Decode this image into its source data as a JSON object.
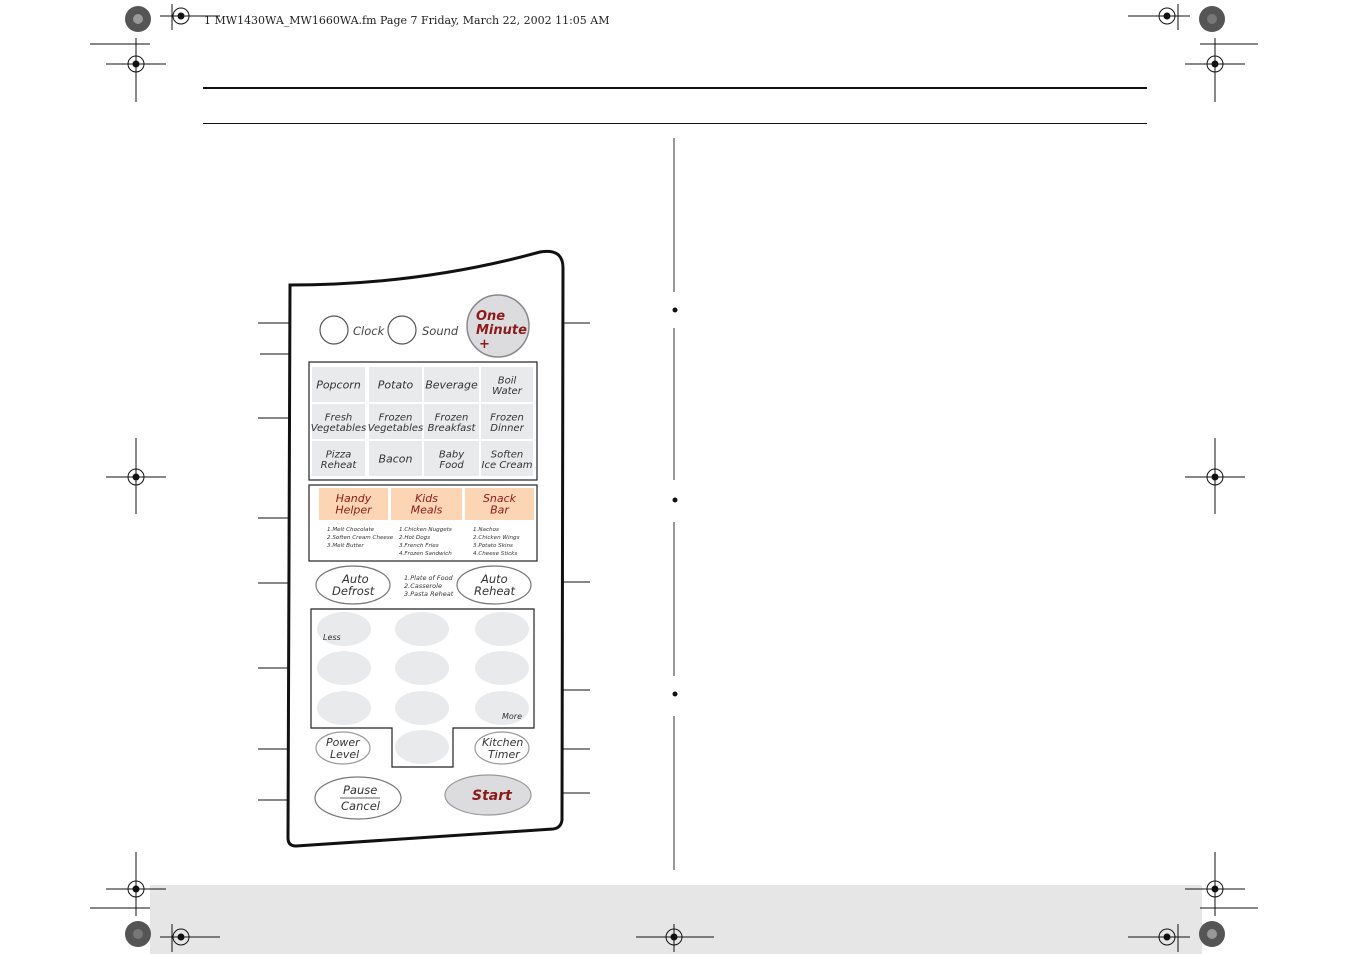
{
  "header": {
    "file_line": "1 MW1430WA_MW1660WA.fm  Page 7  Friday, March 22, 2002  11:05 AM"
  },
  "panel": {
    "clock": "Clock",
    "sound": "Sound",
    "one_minute": [
      "One",
      "Minute",
      "+"
    ],
    "food_grid": [
      [
        [
          "Popcorn"
        ],
        [
          "Potato"
        ],
        [
          "Beverage"
        ],
        [
          "Boil",
          "Water"
        ]
      ],
      [
        [
          "Fresh",
          "Vegetables"
        ],
        [
          "Frozen",
          "Vegetables"
        ],
        [
          "Frozen",
          "Breakfast"
        ],
        [
          "Frozen",
          "Dinner"
        ]
      ],
      [
        [
          "Pizza",
          "Reheat"
        ],
        [
          "Bacon"
        ],
        [
          "Baby",
          "Food"
        ],
        [
          "Soften",
          "Ice Cream"
        ]
      ]
    ],
    "orange_buttons": [
      {
        "label": [
          "Handy",
          "Helper"
        ],
        "items": [
          "1.Melt Chocolate",
          "2.Soften Cream Cheese",
          "3.Melt Butter"
        ]
      },
      {
        "label": [
          "Kids",
          "Meals"
        ],
        "items": [
          "1.Chicken Nuggets",
          "2.Hot Dogs",
          "3.French Fries",
          "4.Frozen Sandwich"
        ]
      },
      {
        "label": [
          "Snack",
          "Bar"
        ],
        "items": [
          "1.Nachos",
          "2.Chicken Wings",
          "3.Potato Skins",
          "4.Cheese Sticks"
        ]
      }
    ],
    "auto_defrost": [
      "Auto",
      "Defrost"
    ],
    "auto_reheat": [
      "Auto",
      "Reheat"
    ],
    "reheat_items": [
      "1.Plate of Food",
      "2.Casserole",
      "3.Pasta Reheat"
    ],
    "less": "Less",
    "more": "More",
    "power_level": [
      "Power",
      "Level"
    ],
    "kitchen_timer": [
      "Kitchen",
      "Timer"
    ],
    "pause": "Pause",
    "cancel": "Cancel",
    "start": "Start"
  },
  "colors": {
    "accent_red": "#8b1a1a",
    "orange_fill": "#fcd5b5",
    "key_gray": "#e9eaec",
    "footer_band": "#e6e6e6"
  }
}
